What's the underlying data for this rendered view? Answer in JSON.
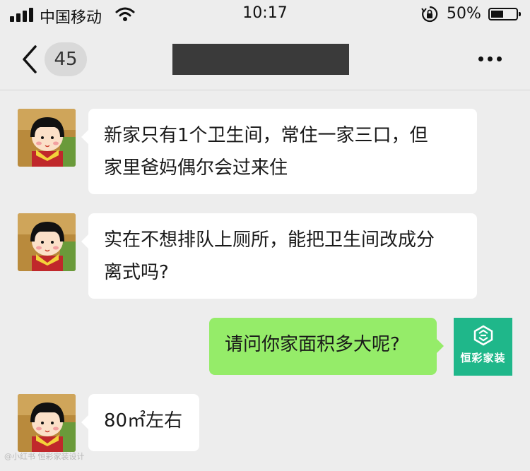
{
  "status_bar": {
    "carrier": "中国移动",
    "time": "10:17",
    "battery_percent": "50%",
    "battery_level": 0.5
  },
  "nav": {
    "unread_count": "45",
    "more_icon": "more-icon"
  },
  "messages": [
    {
      "side": "left",
      "text_lines": [
        "新家只有1个卫生间，常住一家三口，但",
        "家里爸妈偶尔会过来住"
      ]
    },
    {
      "side": "left",
      "text_lines": [
        "实在不想排队上厕所，能把卫生间改成分",
        "离式吗?"
      ]
    },
    {
      "side": "right",
      "text_lines": [
        "请问你家面积多大呢?"
      ],
      "avatar_label": "恒彩家装"
    },
    {
      "side": "left",
      "text_lines": [
        "80㎡左右"
      ]
    }
  ],
  "colors": {
    "background": "#ededed",
    "outgoing_bubble": "#95ec69",
    "incoming_bubble": "#ffffff",
    "brand_avatar": "#1fb78a"
  },
  "watermark": "@小红书 恒彩家装设计"
}
